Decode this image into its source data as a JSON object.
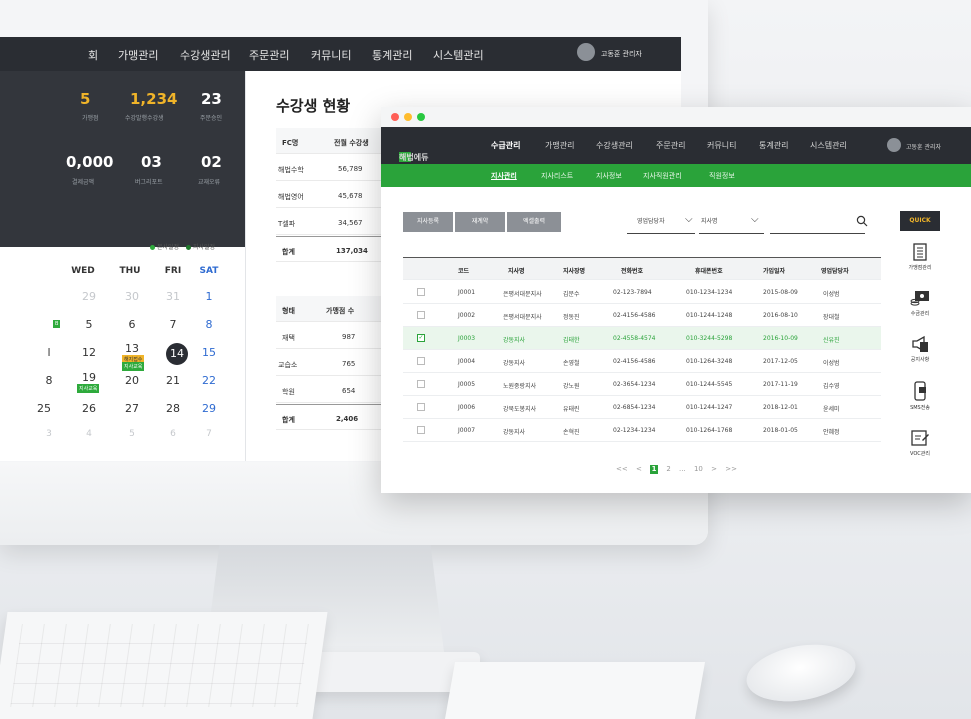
{
  "back": {
    "nav": [
      "회",
      "가맹관리",
      "수강생관리",
      "주문관리",
      "커뮤니티",
      "통계관리",
      "시스템관리"
    ],
    "user": "고동훈 관리자",
    "stats": [
      {
        "value": "5",
        "label": "가맹점"
      },
      {
        "value": "1,234",
        "label": "수강발행수강생"
      },
      {
        "value": "23",
        "label": "주문승인"
      },
      {
        "value": "0,000",
        "label": "결제금액"
      },
      {
        "value": "03",
        "label": "버그리포트"
      },
      {
        "value": "02",
        "label": "교재오류"
      }
    ],
    "legend": [
      "본사일정",
      "지사일정"
    ],
    "calendar": {
      "days": [
        "WED",
        "THU",
        "FRI",
        "SAT"
      ],
      "rows": [
        [
          "29",
          "30",
          "31",
          "1"
        ],
        [
          "5",
          "6",
          "7",
          "8"
        ],
        [
          "l",
          "12",
          "13",
          "14",
          "15"
        ],
        [
          "8",
          "19",
          "20",
          "21",
          "22"
        ],
        [
          "25",
          "26",
          "27",
          "28",
          "29"
        ],
        [
          "3",
          "4",
          "5",
          "6",
          "7"
        ]
      ],
      "tags": [
        "B",
        "해지접수",
        "지사교육",
        "지사교육"
      ]
    },
    "title": "수강생 현황",
    "table1": {
      "head": [
        "FC명",
        "전월 수강생"
      ],
      "rows": [
        [
          "해법수학",
          "56,789"
        ],
        [
          "해법영어",
          "45,678"
        ],
        [
          "T셀파",
          "34,567"
        ]
      ],
      "total": [
        "합계",
        "137,034"
      ]
    },
    "table2": {
      "head": [
        "형태",
        "가맹점 수"
      ],
      "rows": [
        [
          "재택",
          "987"
        ],
        [
          "교습소",
          "765"
        ],
        [
          "학원",
          "654"
        ]
      ],
      "total": [
        "합계",
        "2,406"
      ]
    }
  },
  "front": {
    "logo": "해법에듀",
    "nav": [
      "수급관리",
      "가맹관리",
      "수강생관리",
      "주문관리",
      "커뮤니티",
      "통계관리",
      "시스템관리"
    ],
    "user": "고동훈 관리자",
    "subnav": [
      "지사관리",
      "지사리스트",
      "지사정보",
      "지사직원관리",
      "직원정보"
    ],
    "buttons": [
      "지사등록",
      "재계약",
      "엑셀출력"
    ],
    "filters": [
      "영업담당자",
      "지사명"
    ],
    "quick": {
      "label": "QUICK",
      "items": [
        {
          "label": "가맹점관리",
          "icon": "list-icon"
        },
        {
          "label": "수금관리",
          "icon": "cash-icon"
        },
        {
          "label": "공지사항",
          "icon": "megaphone-icon"
        },
        {
          "label": "SMS전송",
          "icon": "phone-icon"
        },
        {
          "label": "VOC관리",
          "icon": "edit-icon"
        }
      ]
    },
    "table": {
      "head": [
        "코드",
        "지사명",
        "지사장명",
        "전화번호",
        "휴대폰번호",
        "가입일자",
        "영업담당자"
      ],
      "rows": [
        [
          "J0001",
          "은평서대문지사",
          "김문수",
          "02-123-7894",
          "010-1234-1234",
          "2015-08-09",
          "이성범"
        ],
        [
          "J0002",
          "은평서대문지사",
          "정동진",
          "02-4156-4586",
          "010-1244-1248",
          "2016-08-10",
          "장대철"
        ],
        [
          "J0003",
          "강동지사",
          "김태한",
          "02-4558-4574",
          "010-3244-5298",
          "2016-10-09",
          "신유진"
        ],
        [
          "J0004",
          "강동지사",
          "손영철",
          "02-4156-4586",
          "010-1264-3248",
          "2017-12-05",
          "이성범"
        ],
        [
          "J0005",
          "노원중랑지사",
          "강노원",
          "02-3654-1234",
          "010-1244-5545",
          "2017-11-19",
          "김수영"
        ],
        [
          "J0006",
          "강북도봉지사",
          "유태린",
          "02-6854-1234",
          "010-1244-1247",
          "2018-12-01",
          "윤세미"
        ],
        [
          "J0007",
          "강동지사",
          "손혁진",
          "02-1234-1234",
          "010-1264-1768",
          "2018-01-05",
          "안혜정"
        ]
      ],
      "selected_index": 2
    },
    "pager": [
      "<<",
      "<",
      "1",
      "2",
      "...",
      "10",
      ">",
      ">>"
    ],
    "colors": {
      "green": "#2aa33a",
      "dark": "#2a2d33"
    }
  }
}
